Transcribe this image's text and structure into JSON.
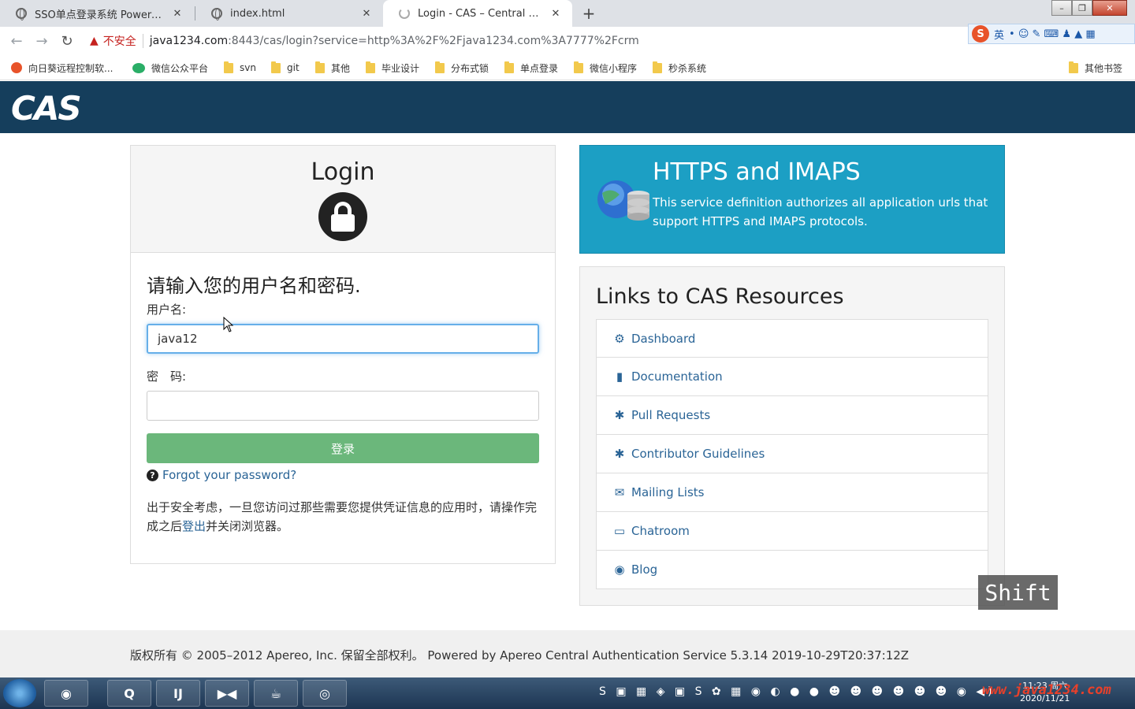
{
  "browser": {
    "tabs": [
      {
        "title": "SSO单点登录系统 Powered by",
        "close": "✕"
      },
      {
        "title": "index.html",
        "close": "✕"
      },
      {
        "title": "Login - CAS – Central Authent",
        "close": "✕"
      }
    ],
    "new_tab": "+",
    "window_controls": {
      "minimize": "–",
      "maximize": "❐",
      "close": "✕"
    },
    "back": "←",
    "forward": "→",
    "reload": "↻",
    "warning_icon": "▲",
    "insecure_label": "不安全",
    "url_host": "java1234.com",
    "url_path": ":8443/cas/login?service=http%3A%2F%2Fjava1234.com%3A7777%2Fcrm",
    "ime": {
      "logo": "S",
      "lang": "英",
      "icons": "• ☺ ✎ ⌨ ♟ ▲ ▦"
    },
    "bookmarks": [
      "向日葵远程控制软...",
      "微信公众平台",
      "svn",
      "git",
      "其他",
      "毕业设计",
      "分布式锁",
      "单点登录",
      "微信小程序",
      "秒杀系统"
    ],
    "other_bookmarks": "其他书签"
  },
  "cas": {
    "logo_text": "CAS",
    "login": {
      "title": "Login",
      "prompt": "请输入您的用户名和密码.",
      "username_label": "用户名:",
      "username_value": "java12",
      "password_label": "密　码:",
      "password_value": "",
      "submit_label": "登录",
      "forgot_icon": "?",
      "forgot_label": "Forgot your password?",
      "notice_before": "出于安全考虑，一旦您访问过那些需要您提供凭证信息的应用时，请操作完成之后",
      "notice_link": "登出",
      "notice_after": "并关闭浏览器。"
    },
    "service": {
      "title": "HTTPS and IMAPS",
      "description": "This service definition authorizes all application urls that support HTTPS and IMAPS protocols."
    },
    "resources": {
      "title": "Links to CAS Resources",
      "items": [
        {
          "label": "Dashboard",
          "icon": "⚙"
        },
        {
          "label": "Documentation",
          "icon": "▮"
        },
        {
          "label": "Pull Requests",
          "icon": "✱"
        },
        {
          "label": "Contributor Guidelines",
          "icon": "✱"
        },
        {
          "label": "Mailing Lists",
          "icon": "✉"
        },
        {
          "label": "Chatroom",
          "icon": "▭"
        },
        {
          "label": "Blog",
          "icon": "◉"
        }
      ]
    },
    "footer": "版权所有 © 2005–2012 Apereo, Inc. 保留全部权利。 Powered by Apereo Central Authentication Service 5.3.14 2019-10-29T20:37:12Z"
  },
  "overlay": {
    "key_badge": "Shift"
  },
  "taskbar": {
    "apps": [
      "◉",
      "Q",
      "IJ",
      "▶◀",
      "☕",
      "◎"
    ],
    "tray": "S ▣ ▦ ◈ ▣ S ✿ ▦ ◉ ◐ ● ● ☻ ☻ ☻ ☻ ☻ ☻ ◉ ◀)",
    "time": "11:23 周六",
    "date": "2020/11/21"
  },
  "watermark": "www.java1234.com"
}
